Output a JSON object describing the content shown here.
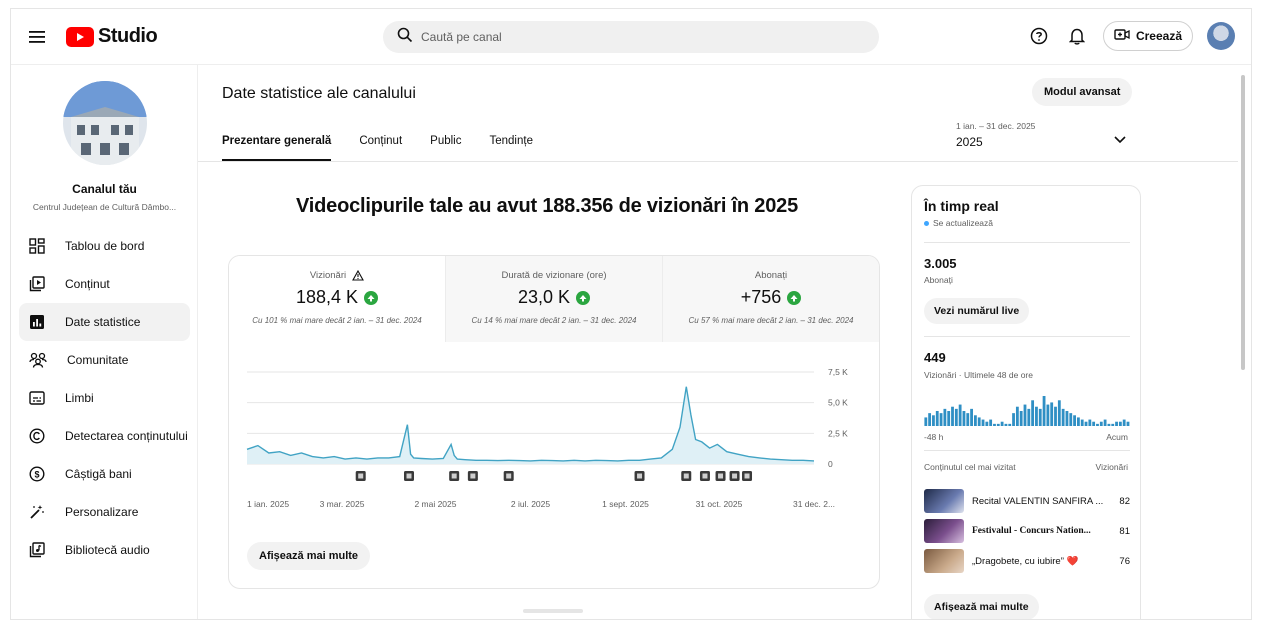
{
  "topbar": {
    "logo_text": "Studio",
    "search_placeholder": "Caută pe canal",
    "create_label": "Creează"
  },
  "sidebar": {
    "channel_title": "Canalul tău",
    "channel_name": "Centrul Județean de Cultură Dâmbo...",
    "items": [
      {
        "label": "Tablou de bord",
        "icon": "dashboard-icon"
      },
      {
        "label": "Conținut",
        "icon": "content-icon"
      },
      {
        "label": "Date statistice",
        "icon": "analytics-icon",
        "active": true
      },
      {
        "label": "Comunitate",
        "icon": "community-icon"
      },
      {
        "label": "Limbi",
        "icon": "subtitles-icon"
      },
      {
        "label": "Detectarea conținutului",
        "icon": "copyright-icon"
      },
      {
        "label": "Câștigă bani",
        "icon": "monetization-icon"
      },
      {
        "label": "Personalizare",
        "icon": "magic-wand-icon"
      },
      {
        "label": "Bibliotecă audio",
        "icon": "audio-library-icon"
      }
    ]
  },
  "main": {
    "title": "Date statistice ale canalului",
    "advanced_mode": "Modul avansat",
    "tabs": [
      {
        "label": "Prezentare generală",
        "active": true
      },
      {
        "label": "Conținut"
      },
      {
        "label": "Public"
      },
      {
        "label": "Tendințe"
      }
    ],
    "date_range": "1 ian. – 31 dec. 2025",
    "date_year": "2025",
    "headline": "Videoclipurile tale au avut 188.356 de vizionări în 2025",
    "metrics": [
      {
        "label": "Vizionări",
        "value": "188,4 K",
        "compare": "Cu 101 % mai mare decât 2 ian. – 31 dec. 2024",
        "warning": true
      },
      {
        "label": "Durată de vizionare (ore)",
        "value": "23,0 K",
        "compare": "Cu 14 % mai mare decât 2 ian. – 31 dec. 2024"
      },
      {
        "label": "Abonați",
        "value": "+756",
        "compare": "Cu 57 % mai mare decât 2 ian. – 31 dec. 2024"
      }
    ],
    "show_more": "Afișează mai multe"
  },
  "chart_data": {
    "type": "line",
    "x_tick_labels": [
      "1 ian. 2025",
      "3 mar. 2025",
      "2 mai 2025",
      "2 iul. 2025",
      "1 sept. 2025",
      "31 oct. 2025",
      "31 dec. 2..."
    ],
    "y_tick_labels": [
      "7,5 K",
      "5,0 K",
      "2,5 K",
      "0"
    ],
    "ylim": [
      0,
      7500
    ],
    "grid": true,
    "series": [
      {
        "color": "#41a3c4",
        "x": [
          "2025-01-01",
          "2025-01-08",
          "2025-01-15",
          "2025-01-22",
          "2025-01-29",
          "2025-02-05",
          "2025-02-12",
          "2025-02-19",
          "2025-02-26",
          "2025-03-05",
          "2025-03-12",
          "2025-03-19",
          "2025-03-26",
          "2025-04-02",
          "2025-04-09",
          "2025-04-14",
          "2025-04-16",
          "2025-04-18",
          "2025-04-23",
          "2025-04-30",
          "2025-05-07",
          "2025-05-12",
          "2025-05-14",
          "2025-05-16",
          "2025-05-21",
          "2025-05-28",
          "2025-06-04",
          "2025-06-11",
          "2025-06-18",
          "2025-06-25",
          "2025-07-02",
          "2025-07-09",
          "2025-07-16",
          "2025-07-23",
          "2025-07-30",
          "2025-08-06",
          "2025-08-13",
          "2025-08-20",
          "2025-08-27",
          "2025-09-03",
          "2025-09-10",
          "2025-09-17",
          "2025-09-24",
          "2025-10-01",
          "2025-10-06",
          "2025-10-10",
          "2025-10-13",
          "2025-10-16",
          "2025-10-20",
          "2025-10-25",
          "2025-10-30",
          "2025-11-05",
          "2025-11-12",
          "2025-11-19",
          "2025-11-26",
          "2025-12-03",
          "2025-12-10",
          "2025-12-17",
          "2025-12-24",
          "2025-12-31"
        ],
        "y": [
          1200,
          1500,
          900,
          1000,
          700,
          900,
          600,
          500,
          600,
          400,
          500,
          400,
          500,
          500,
          600,
          3200,
          800,
          500,
          450,
          400,
          450,
          1600,
          700,
          400,
          350,
          300,
          300,
          280,
          300,
          280,
          250,
          300,
          280,
          250,
          300,
          250,
          300,
          280,
          250,
          300,
          300,
          400,
          500,
          1200,
          3000,
          6300,
          4000,
          2000,
          1800,
          1300,
          1600,
          1000,
          800,
          600,
          500,
          400,
          350,
          300,
          300,
          250
        ]
      }
    ]
  },
  "realtime": {
    "title": "În timp real",
    "updating": "Se actualizează",
    "subs_value": "3.005",
    "subs_label": "Abonați",
    "live_btn": "Vezi numărul live",
    "views_value": "449",
    "views_label": "Vizionări · Ultimele 48 de ore",
    "axis_left": "-48 h",
    "axis_right": "Acum",
    "bars": [
      4,
      6,
      5,
      7,
      6,
      8,
      7,
      9,
      8,
      10,
      7,
      6,
      8,
      5,
      4,
      3,
      2,
      3,
      1,
      1,
      2,
      1,
      1,
      6,
      9,
      7,
      10,
      8,
      12,
      9,
      8,
      14,
      10,
      11,
      9,
      12,
      8,
      7,
      6,
      5,
      4,
      3,
      2,
      3,
      2,
      1,
      2,
      3,
      1,
      1,
      2,
      2,
      3,
      2
    ],
    "list_header_left": "Conținutul cel mai vizitat",
    "list_header_right": "Vizionări",
    "items": [
      {
        "title": "Recital VALENTIN SANFIRA ...",
        "count": "82",
        "thumb": "#3c4a72"
      },
      {
        "title": "Festivalul - Concurs Nation...",
        "count": "81",
        "thumb": "#5b3b6b"
      },
      {
        "title": "„Dragobete, cu iubire” ❤️",
        "count": "76",
        "thumb": "#b08a6a"
      }
    ],
    "show_more": "Afișează mai multe"
  }
}
